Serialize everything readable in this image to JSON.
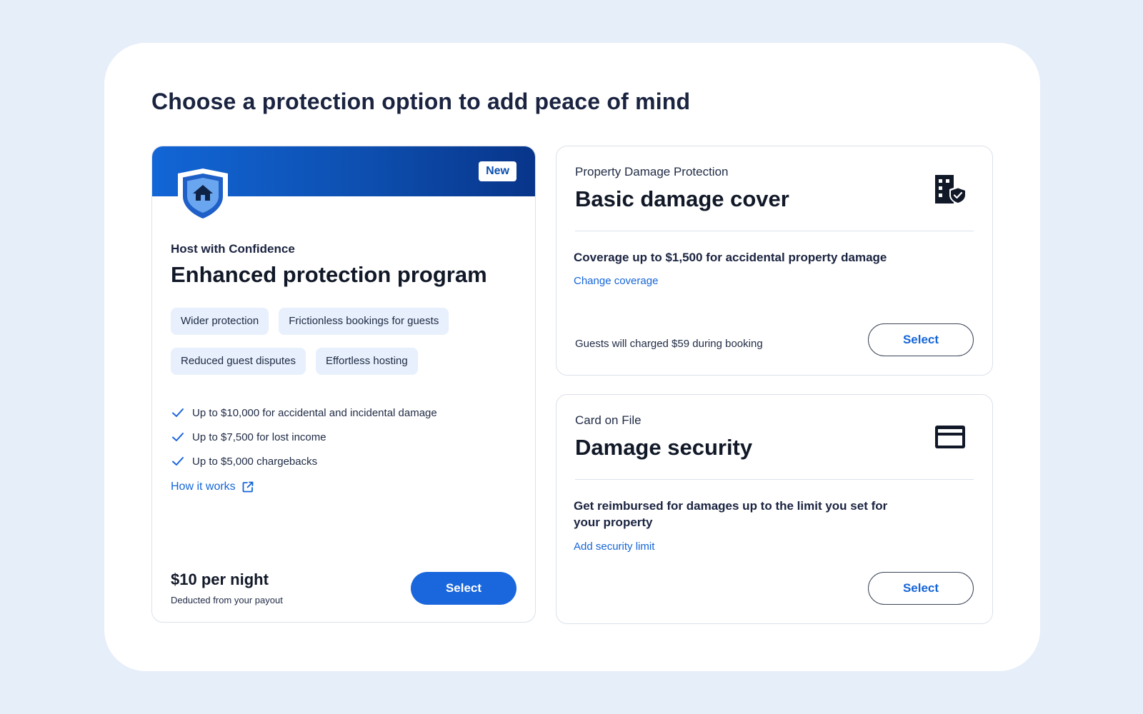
{
  "page": {
    "title": "Choose a protection option to add peace of mind"
  },
  "featured": {
    "badge": "New",
    "overline": "Host with Confidence",
    "title": "Enhanced protection program",
    "chips": [
      "Wider protection",
      "Frictionless bookings for guests",
      "Reduced guest disputes",
      "Effortless hosting"
    ],
    "benefits": [
      "Up to $10,000 for accidental and incidental damage",
      "Up to $7,500 for lost income",
      "Up to $5,000 chargebacks"
    ],
    "link": "How it works",
    "price": "$10 per night",
    "price_note": "Deducted from your payout",
    "button": "Select",
    "icon": "shield-home-icon"
  },
  "basic": {
    "overline": "Property Damage Protection",
    "title": "Basic damage cover",
    "description": "Coverage up to $1,500 for accidental property damage",
    "link": "Change coverage",
    "footnote": "Guests will charged $59 during booking",
    "button": "Select",
    "icon": "building-shield-icon"
  },
  "security": {
    "overline": "Card on File",
    "title": "Damage security",
    "description": "Get reimbursed for damages up to the limit you set for your property",
    "link": "Add security limit",
    "button": "Select",
    "icon": "credit-card-icon"
  },
  "colors": {
    "primary": "#1a66dc",
    "link": "#1565d8",
    "chip_bg": "#e7f0fc",
    "page_bg": "#e6eefa"
  }
}
